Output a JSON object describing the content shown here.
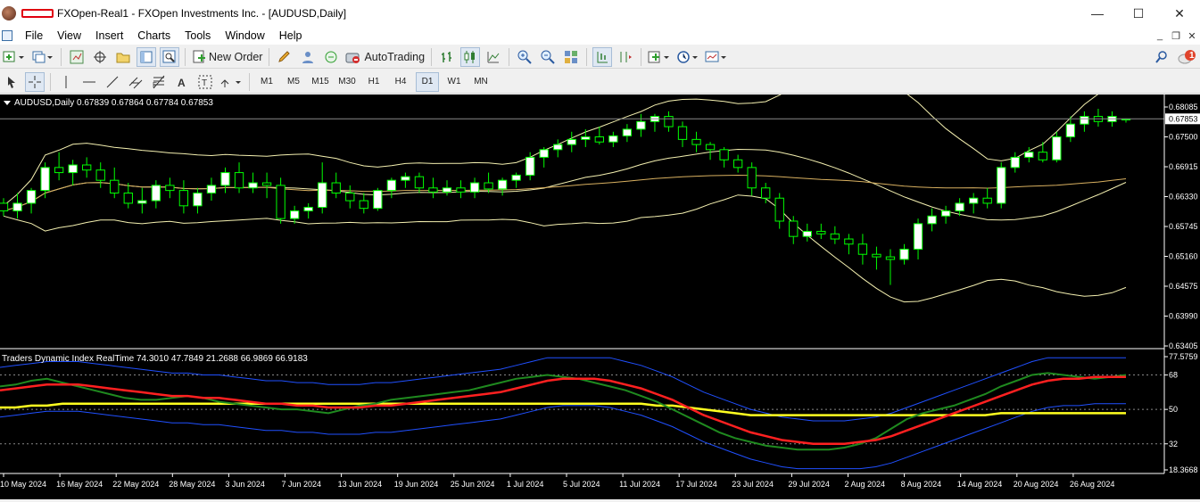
{
  "window": {
    "title": "FXOpen-Real1 - FXOpen Investments Inc. - [AUDUSD,Daily]",
    "minimize_icon": "minimize-icon",
    "maximize_icon": "maximize-icon",
    "close_icon": "close-icon"
  },
  "menu": {
    "items": [
      "File",
      "View",
      "Insert",
      "Charts",
      "Tools",
      "Window",
      "Help"
    ]
  },
  "toolbar": {
    "new_order_label": "New Order",
    "autotrading_label": "AutoTrading",
    "notification_count": "1"
  },
  "timeframes": [
    "M1",
    "M5",
    "M15",
    "M30",
    "H1",
    "H4",
    "D1",
    "W1",
    "MN"
  ],
  "active_timeframe": "D1",
  "chart": {
    "header": "AUDUSD,Daily  0.67839 0.67864 0.67784 0.67853",
    "current_price": "0.67853",
    "price_ticks": [
      "0.68085",
      "0.67500",
      "0.66915",
      "0.66330",
      "0.65745",
      "0.65160",
      "0.64575",
      "0.63990",
      "0.63405"
    ],
    "date_ticks": [
      "10 May 2024",
      "16 May 2024",
      "22 May 2024",
      "28 May 2024",
      "3 Jun 2024",
      "7 Jun 2024",
      "13 Jun 2024",
      "19 Jun 2024",
      "25 Jun 2024",
      "1 Jul 2024",
      "5 Jul 2024",
      "11 Jul 2024",
      "17 Jul 2024",
      "23 Jul 2024",
      "29 Jul 2024",
      "2 Aug 2024",
      "8 Aug 2024",
      "14 Aug 2024",
      "20 Aug 2024",
      "26 Aug 2024"
    ],
    "colors": {
      "background": "#000000",
      "bull": "#ffffff",
      "bear": "#000000",
      "wick": "#00ff00",
      "bands": "#f4f0b0",
      "ma": "#d8b060"
    }
  },
  "indicator": {
    "header": "Traders Dynamic Index RealTime 74.3010 47.7849 21.2688 66.9869 66.9183",
    "ticks": [
      "77.5759",
      "68",
      "50",
      "32",
      "18.3668"
    ],
    "colors": {
      "rsi": "#1f8a1f",
      "signal": "#ff2020",
      "base": "#ffff20",
      "band": "#2050ff"
    }
  },
  "chart_data": {
    "type": "candlestick",
    "symbol": "AUDUSD",
    "timeframe": "Daily",
    "ylim": [
      0.63405,
      0.68085
    ],
    "dates": [
      "10 May 2024",
      "16 May 2024",
      "22 May 2024",
      "28 May 2024",
      "3 Jun 2024",
      "7 Jun 2024",
      "13 Jun 2024",
      "19 Jun 2024",
      "25 Jun 2024",
      "1 Jul 2024",
      "5 Jul 2024",
      "11 Jul 2024",
      "17 Jul 2024",
      "23 Jul 2024",
      "29 Jul 2024",
      "2 Aug 2024",
      "8 Aug 2024",
      "14 Aug 2024",
      "20 Aug 2024",
      "26 Aug 2024"
    ],
    "candles": [
      [
        0.662,
        0.663,
        0.6595,
        0.6605
      ],
      [
        0.6605,
        0.664,
        0.659,
        0.662
      ],
      [
        0.662,
        0.665,
        0.66,
        0.6645
      ],
      [
        0.6645,
        0.67,
        0.663,
        0.669
      ],
      [
        0.669,
        0.672,
        0.6665,
        0.668
      ],
      [
        0.668,
        0.6705,
        0.6655,
        0.6695
      ],
      [
        0.6695,
        0.671,
        0.667,
        0.6685
      ],
      [
        0.6685,
        0.67,
        0.665,
        0.6665
      ],
      [
        0.6665,
        0.669,
        0.663,
        0.664
      ],
      [
        0.664,
        0.666,
        0.661,
        0.662
      ],
      [
        0.662,
        0.665,
        0.66,
        0.6625
      ],
      [
        0.6625,
        0.6665,
        0.661,
        0.6655
      ],
      [
        0.6655,
        0.667,
        0.663,
        0.6645
      ],
      [
        0.6645,
        0.6665,
        0.66,
        0.6615
      ],
      [
        0.6615,
        0.665,
        0.66,
        0.664
      ],
      [
        0.664,
        0.667,
        0.6625,
        0.6655
      ],
      [
        0.6655,
        0.669,
        0.664,
        0.668
      ],
      [
        0.668,
        0.67,
        0.664,
        0.665
      ],
      [
        0.665,
        0.668,
        0.664,
        0.666
      ],
      [
        0.666,
        0.668,
        0.663,
        0.6655
      ],
      [
        0.6655,
        0.667,
        0.658,
        0.659
      ],
      [
        0.659,
        0.6615,
        0.658,
        0.6605
      ],
      [
        0.6605,
        0.662,
        0.659,
        0.6612
      ],
      [
        0.6612,
        0.67,
        0.66,
        0.666
      ],
      [
        0.666,
        0.668,
        0.663,
        0.664
      ],
      [
        0.664,
        0.6655,
        0.661,
        0.6625
      ],
      [
        0.6625,
        0.664,
        0.66,
        0.661
      ],
      [
        0.661,
        0.665,
        0.6605,
        0.6645
      ],
      [
        0.6645,
        0.667,
        0.663,
        0.6665
      ],
      [
        0.6665,
        0.668,
        0.665,
        0.6672
      ],
      [
        0.6672,
        0.668,
        0.664,
        0.665
      ],
      [
        0.665,
        0.667,
        0.663,
        0.6642
      ],
      [
        0.6642,
        0.6665,
        0.6635,
        0.665
      ],
      [
        0.665,
        0.6665,
        0.663,
        0.6642
      ],
      [
        0.6642,
        0.667,
        0.663,
        0.666
      ],
      [
        0.666,
        0.668,
        0.664,
        0.6648
      ],
      [
        0.6648,
        0.667,
        0.6635,
        0.6665
      ],
      [
        0.6665,
        0.668,
        0.665,
        0.6675
      ],
      [
        0.6675,
        0.672,
        0.6665,
        0.671
      ],
      [
        0.671,
        0.673,
        0.669,
        0.6725
      ],
      [
        0.6725,
        0.6745,
        0.671,
        0.6735
      ],
      [
        0.6735,
        0.676,
        0.672,
        0.6745
      ],
      [
        0.6745,
        0.6765,
        0.673,
        0.675
      ],
      [
        0.675,
        0.677,
        0.6735,
        0.674
      ],
      [
        0.674,
        0.676,
        0.673,
        0.6752
      ],
      [
        0.6752,
        0.6775,
        0.674,
        0.6765
      ],
      [
        0.6765,
        0.6795,
        0.675,
        0.678
      ],
      [
        0.678,
        0.6795,
        0.676,
        0.679
      ],
      [
        0.679,
        0.68,
        0.676,
        0.677
      ],
      [
        0.677,
        0.678,
        0.673,
        0.6745
      ],
      [
        0.6745,
        0.676,
        0.672,
        0.6735
      ],
      [
        0.6735,
        0.674,
        0.6705,
        0.6725
      ],
      [
        0.6725,
        0.673,
        0.669,
        0.6705
      ],
      [
        0.6705,
        0.6715,
        0.668,
        0.669
      ],
      [
        0.669,
        0.67,
        0.6635,
        0.665
      ],
      [
        0.665,
        0.666,
        0.662,
        0.663
      ],
      [
        0.663,
        0.664,
        0.657,
        0.6585
      ],
      [
        0.6585,
        0.6595,
        0.654,
        0.6555
      ],
      [
        0.6555,
        0.658,
        0.6545,
        0.6565
      ],
      [
        0.6565,
        0.658,
        0.655,
        0.656
      ],
      [
        0.656,
        0.6575,
        0.654,
        0.655
      ],
      [
        0.655,
        0.656,
        0.652,
        0.654
      ],
      [
        0.654,
        0.656,
        0.65,
        0.652
      ],
      [
        0.652,
        0.6535,
        0.649,
        0.6515
      ],
      [
        0.6515,
        0.653,
        0.646,
        0.651
      ],
      [
        0.651,
        0.654,
        0.65,
        0.653
      ],
      [
        0.653,
        0.659,
        0.651,
        0.658
      ],
      [
        0.658,
        0.661,
        0.6565,
        0.6595
      ],
      [
        0.6595,
        0.6615,
        0.658,
        0.6605
      ],
      [
        0.6605,
        0.663,
        0.6595,
        0.662
      ],
      [
        0.662,
        0.664,
        0.66,
        0.663
      ],
      [
        0.663,
        0.665,
        0.661,
        0.662
      ],
      [
        0.662,
        0.67,
        0.661,
        0.669
      ],
      [
        0.669,
        0.672,
        0.668,
        0.671
      ],
      [
        0.671,
        0.673,
        0.67,
        0.672
      ],
      [
        0.672,
        0.674,
        0.67,
        0.6705
      ],
      [
        0.6705,
        0.676,
        0.67,
        0.675
      ],
      [
        0.675,
        0.679,
        0.674,
        0.6775
      ],
      [
        0.6775,
        0.68,
        0.676,
        0.679
      ],
      [
        0.679,
        0.6805,
        0.677,
        0.678
      ],
      [
        0.678,
        0.68,
        0.677,
        0.679
      ],
      [
        0.6784,
        0.6786,
        0.6778,
        0.6785
      ]
    ],
    "series": [
      {
        "name": "TDI RSI",
        "values": [
          62,
          63,
          65,
          66,
          64,
          62,
          60,
          58,
          56,
          55,
          55,
          56,
          57,
          56,
          54,
          53,
          52,
          51,
          50,
          50,
          49,
          48,
          50,
          52,
          53,
          55,
          56,
          57,
          58,
          59,
          60,
          62,
          64,
          66,
          67,
          68,
          67,
          66,
          64,
          62,
          60,
          57,
          54,
          50,
          46,
          42,
          38,
          35,
          33,
          31,
          30,
          29,
          29,
          29,
          30,
          32,
          35,
          40,
          45,
          48,
          50,
          52,
          55,
          58,
          62,
          65,
          68,
          69,
          68,
          67,
          66,
          67,
          68
        ]
      },
      {
        "name": "TDI Signal",
        "values": [
          60,
          61,
          62,
          63,
          63,
          63,
          62,
          61,
          60,
          59,
          58,
          57,
          57,
          56,
          56,
          55,
          54,
          53,
          53,
          52,
          52,
          51,
          51,
          51,
          52,
          52,
          53,
          54,
          55,
          56,
          57,
          58,
          59,
          61,
          63,
          65,
          66,
          66,
          66,
          65,
          63,
          61,
          58,
          55,
          51,
          47,
          44,
          41,
          38,
          36,
          34,
          33,
          32,
          32,
          32,
          33,
          34,
          36,
          39,
          42,
          45,
          48,
          51,
          54,
          57,
          60,
          63,
          65,
          66,
          66,
          67,
          67,
          67
        ]
      },
      {
        "name": "TDI Base",
        "values": [
          51,
          51,
          52,
          52,
          53,
          53,
          53,
          53,
          53,
          53,
          53,
          53,
          53,
          53,
          53,
          53,
          53,
          53,
          53,
          53,
          53,
          53,
          53,
          53,
          53,
          53,
          53,
          53,
          53,
          53,
          53,
          53,
          53,
          53,
          53,
          53,
          53,
          53,
          53,
          53,
          53,
          53,
          52,
          52,
          51,
          50,
          49,
          48,
          47,
          47,
          47,
          47,
          47,
          47,
          47,
          47,
          47,
          47,
          47,
          47,
          47,
          47,
          47,
          47,
          48,
          48,
          48,
          48,
          48,
          48,
          48,
          48,
          48
        ]
      }
    ]
  }
}
